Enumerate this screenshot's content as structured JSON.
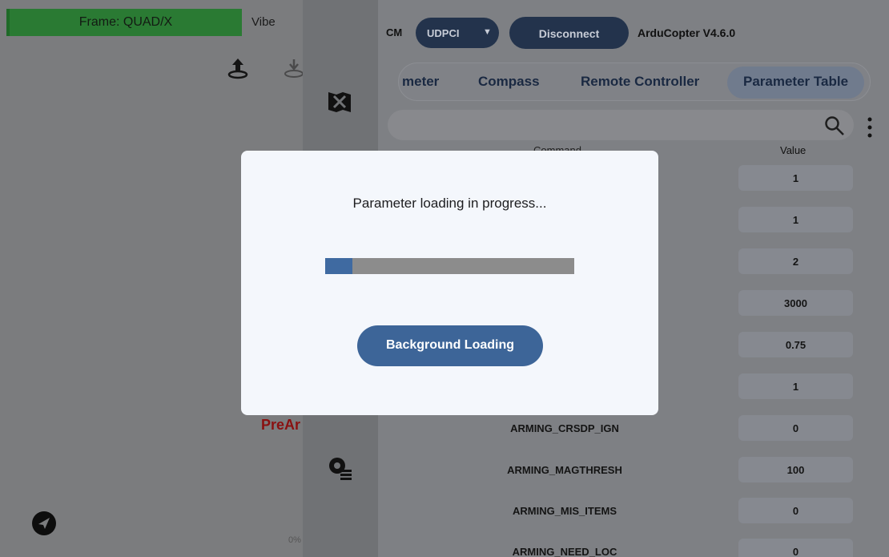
{
  "left_panel": {
    "frame_label": "Frame: QUAD/X",
    "vibe_label": "Vibe",
    "prearm_text": "PreAr",
    "percent_text": "0%"
  },
  "header": {
    "cm_label": "CM",
    "connection_type": "UDPCI",
    "disconnect_label": "Disconnect",
    "firmware_version": "ArduCopter V4.6.0"
  },
  "tabs": [
    "meter",
    "Compass",
    "Remote Controller",
    "Parameter Table"
  ],
  "active_tab": "Parameter Table",
  "table": {
    "col_command": "Command",
    "col_value": "Value",
    "rows": [
      {
        "name": "",
        "value": "1"
      },
      {
        "name": "",
        "value": "1"
      },
      {
        "name": "",
        "value": "2"
      },
      {
        "name": "",
        "value": "3000"
      },
      {
        "name": "",
        "value": "0.75"
      },
      {
        "name": "",
        "value": "1"
      },
      {
        "name": "ARMING_CRSDP_IGN",
        "value": "0"
      },
      {
        "name": "ARMING_MAGTHRESH",
        "value": "100"
      },
      {
        "name": "ARMING_MIS_ITEMS",
        "value": "0"
      },
      {
        "name": "ARMING_NEED_LOC",
        "value": "0"
      }
    ]
  },
  "modal": {
    "title": "Parameter loading in progress...",
    "progress_fraction": 0.11,
    "button_label": "Background Loading"
  },
  "colors": {
    "accent": "#3d6598",
    "frame_badge": "#2a7a33",
    "prearm": "#8a1010"
  },
  "icons": [
    "upload-icon",
    "download-icon",
    "map-icon",
    "settings-icon",
    "search-icon",
    "more-vertical-icon",
    "send-icon"
  ]
}
